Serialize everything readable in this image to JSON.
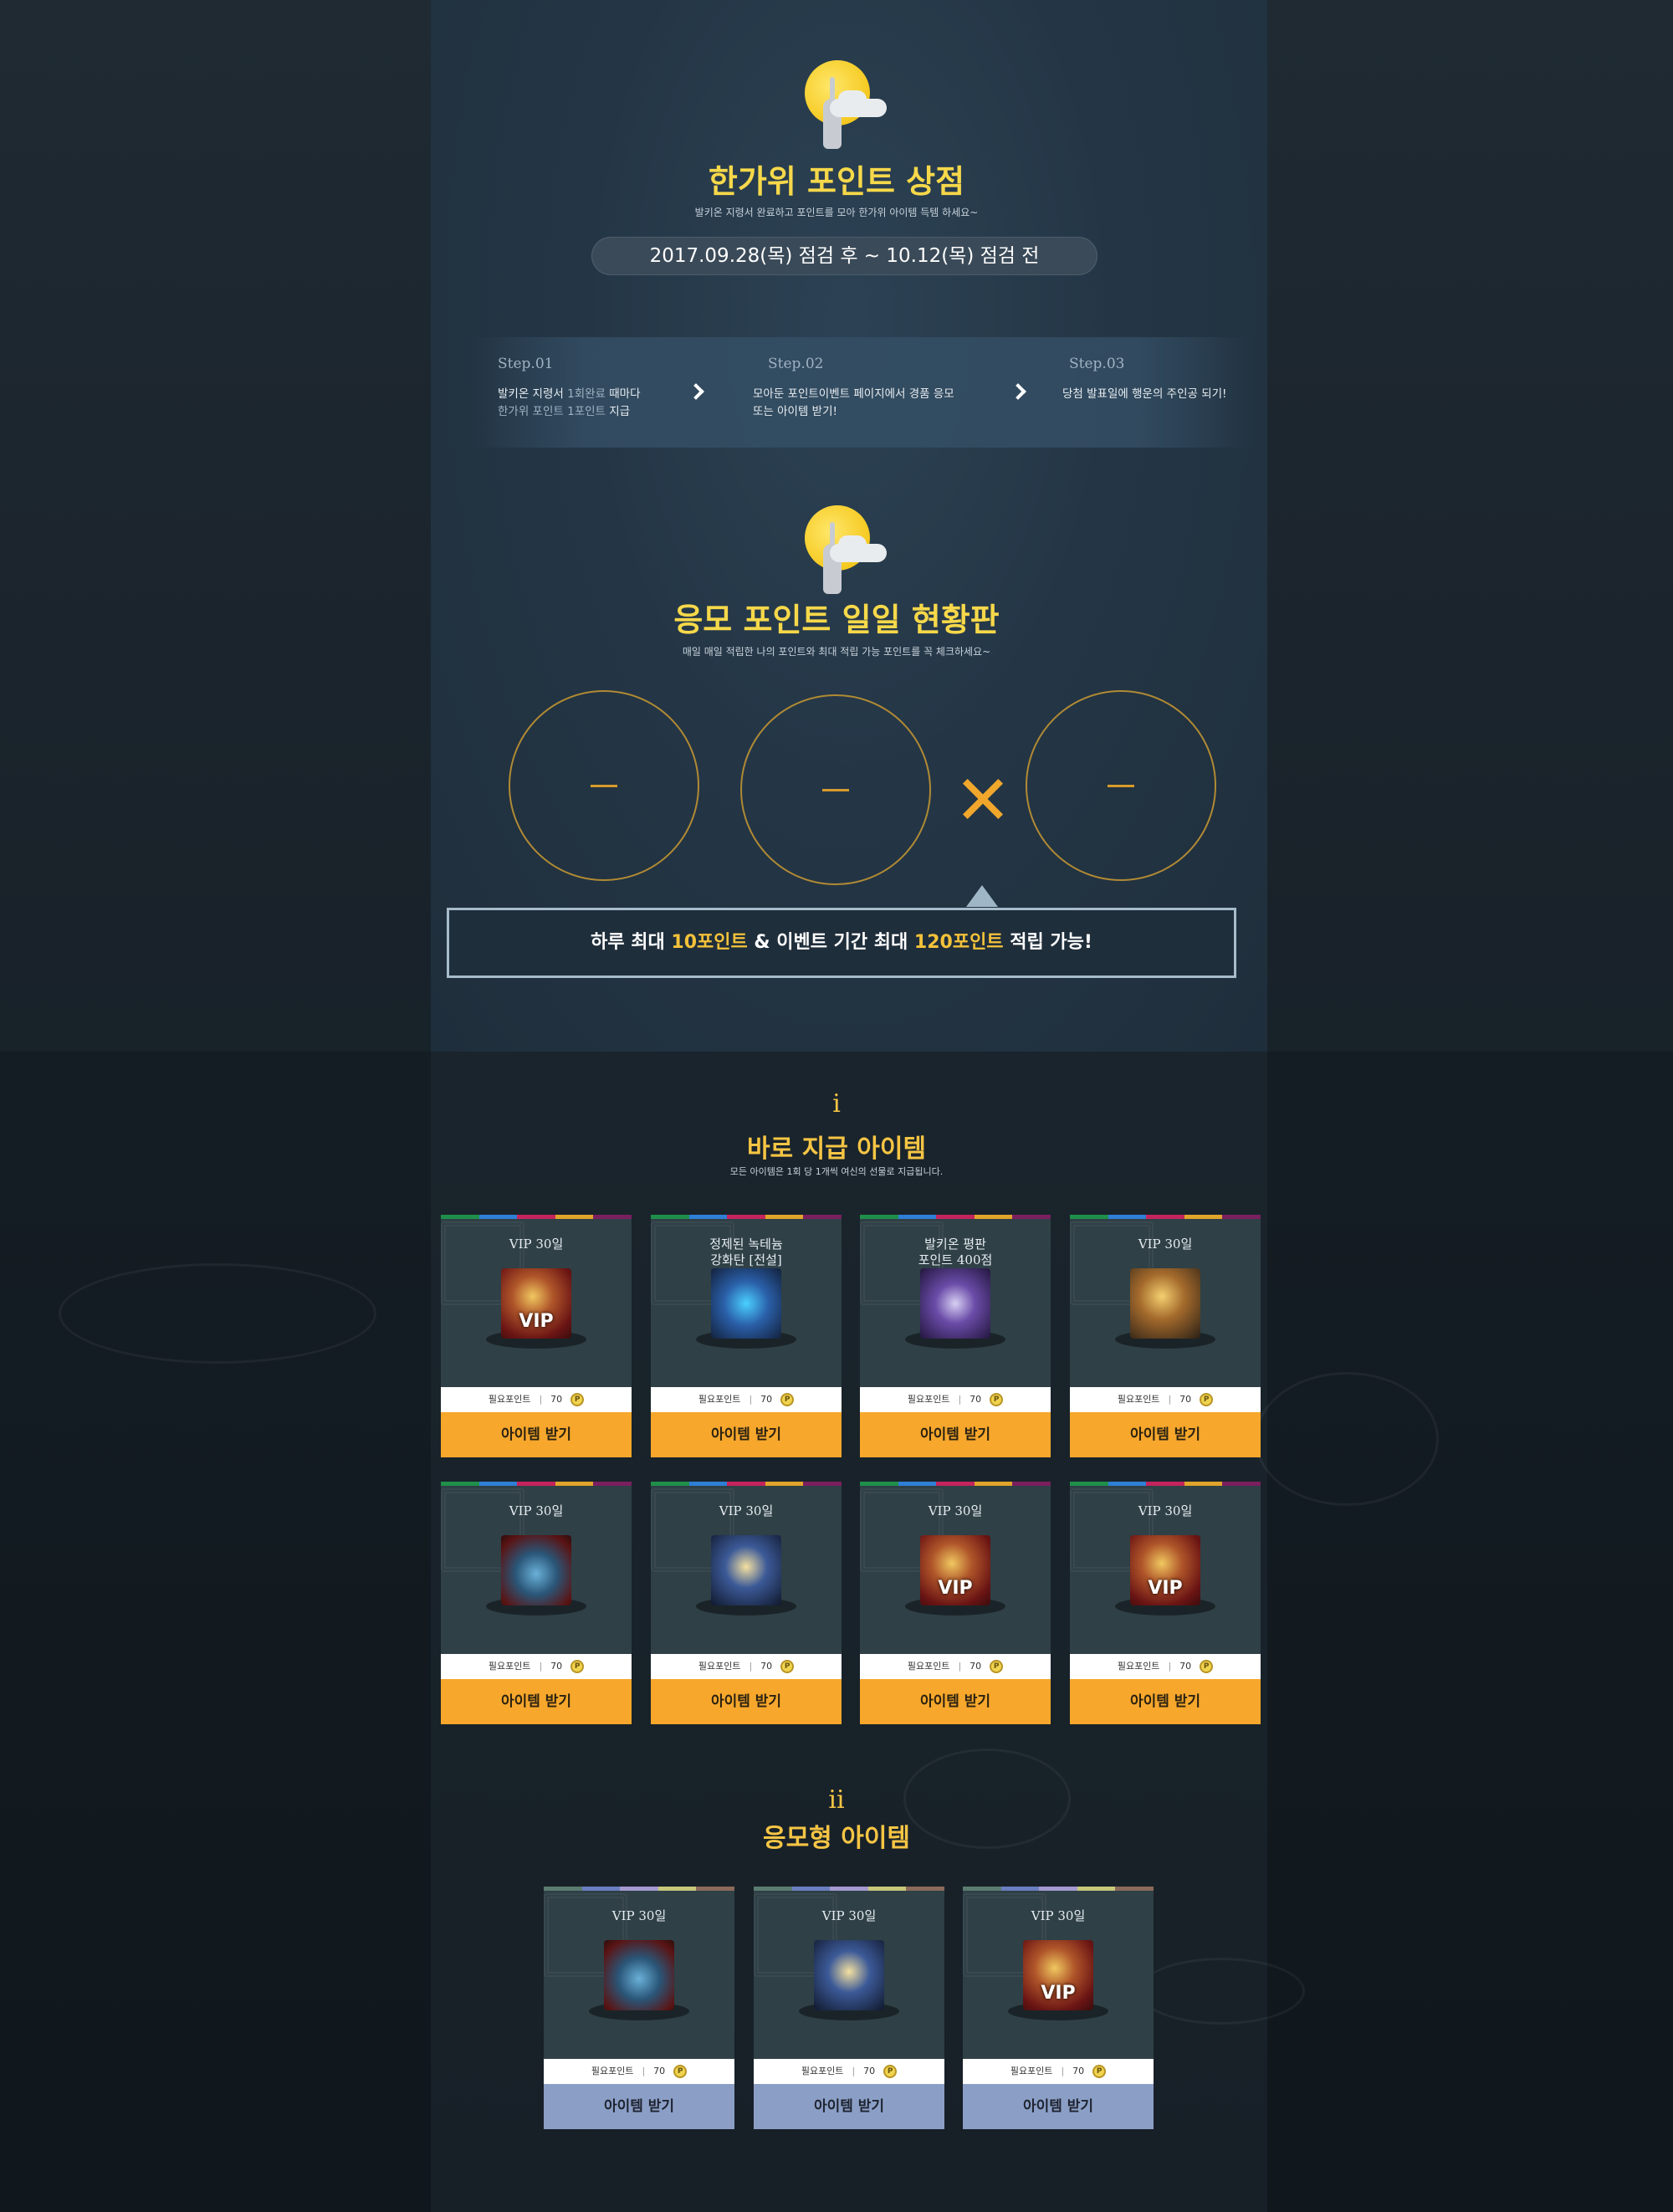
{
  "header": {
    "title": "한가위 포인트 상점",
    "subtitle": "발키온 지령서 완료하고 포인트를 모아 한가위 아이템 득템 하세요~",
    "period": "2017.09.28(목) 점검 후 ~ 10.12(목) 점검 전"
  },
  "steps": [
    {
      "no": "Step.01",
      "line1_a": "발키온 지령서 ",
      "line1_hl": "1회완료",
      "line1_b": " 때마다",
      "line2_hl": "한가위 포인트 1포인트",
      "line2_b": " 지급"
    },
    {
      "no": "Step.02",
      "line1": "모아둔 포인트이벤트 페이지에서 경품 응모",
      "line2": "또는 아이템 받기!"
    },
    {
      "no": "Step.03",
      "line1": "당첨 발표일에 행운의 주인공 되기!"
    }
  ],
  "board": {
    "title": "응모 포인트 일일 현황판",
    "subtitle": "매일 매일 적립한 나의 포인트와 최대 적립 가능 포인트를 꼭 체크하세요~",
    "values": [
      "—",
      "—",
      "—"
    ],
    "notice_a": "하루 최대 ",
    "notice_hl1": "10포인트",
    "notice_b": " & 이벤트 기간 최대 ",
    "notice_hl2": "120포인트",
    "notice_c": " 적립 가능!"
  },
  "section1": {
    "num": "i",
    "title": "바로 지급 아이템",
    "subtitle": "모든 아이템은 1회 당 1개씩 여신의 선물로 지급됩니다.",
    "items": [
      {
        "name": "VIP 30일",
        "icon": "vip-pouch-icon",
        "icon_label": "VIP",
        "points_label": "필요포인트",
        "points": "70",
        "coin": "P",
        "button": "아이템 받기"
      },
      {
        "name": "정제된 녹테늄\n강화탄 [전설]",
        "icon": "enhancement-bullet-icon",
        "icon_label": "",
        "points_label": "필요포인트",
        "points": "70",
        "coin": "P",
        "button": "아이템 받기"
      },
      {
        "name": "발키온 평판\n포인트 400점",
        "icon": "reputation-ring-icon",
        "icon_label": "",
        "points_label": "필요포인트",
        "points": "70",
        "coin": "P",
        "button": "아이템 받기"
      },
      {
        "name": "VIP 30일",
        "icon": "food-platter-icon",
        "icon_label": "",
        "points_label": "필요포인트",
        "points": "70",
        "coin": "P",
        "button": "아이템 받기"
      },
      {
        "name": "VIP 30일",
        "icon": "blue-pouch-icon",
        "icon_label": "",
        "points_label": "필요포인트",
        "points": "70",
        "coin": "P",
        "button": "아이템 받기"
      },
      {
        "name": "VIP 30일",
        "icon": "golden-key-icon",
        "icon_label": "",
        "points_label": "필요포인트",
        "points": "70",
        "coin": "P",
        "button": "아이템 받기"
      },
      {
        "name": "VIP 30일",
        "icon": "vip-pouch-icon",
        "icon_label": "VIP",
        "points_label": "필요포인트",
        "points": "70",
        "coin": "P",
        "button": "아이템 받기"
      },
      {
        "name": "VIP 30일",
        "icon": "vip-pouch-icon",
        "icon_label": "VIP",
        "points_label": "필요포인트",
        "points": "70",
        "coin": "P",
        "button": "아이템 받기"
      }
    ]
  },
  "section2": {
    "num": "ii",
    "title": "응모형 아이템",
    "items": [
      {
        "name": "VIP 30일",
        "icon": "blue-pouch-icon",
        "icon_label": "",
        "points_label": "필요포인트",
        "points": "70",
        "coin": "P",
        "button": "아이템 받기"
      },
      {
        "name": "VIP 30일",
        "icon": "golden-key-icon",
        "icon_label": "",
        "points_label": "필요포인트",
        "points": "70",
        "coin": "P",
        "button": "아이템 받기"
      },
      {
        "name": "VIP 30일",
        "icon": "vip-pouch-icon",
        "icon_label": "VIP",
        "points_label": "필요포인트",
        "points": "70",
        "coin": "P",
        "button": "아이템 받기"
      }
    ]
  },
  "colors": {
    "accent_yellow": "#f6d84a",
    "accent_orange": "#f7a72c",
    "button_blue": "#8b9fc6",
    "stripe": [
      "#1f8f4a",
      "#2f7fd6",
      "#c4245c",
      "#e0a52a",
      "#7a1f5e"
    ],
    "stripe_muted": [
      "#5a7c70",
      "#6a7ec0",
      "#a49ad0",
      "#c8c87a",
      "#8c6a5a"
    ]
  }
}
